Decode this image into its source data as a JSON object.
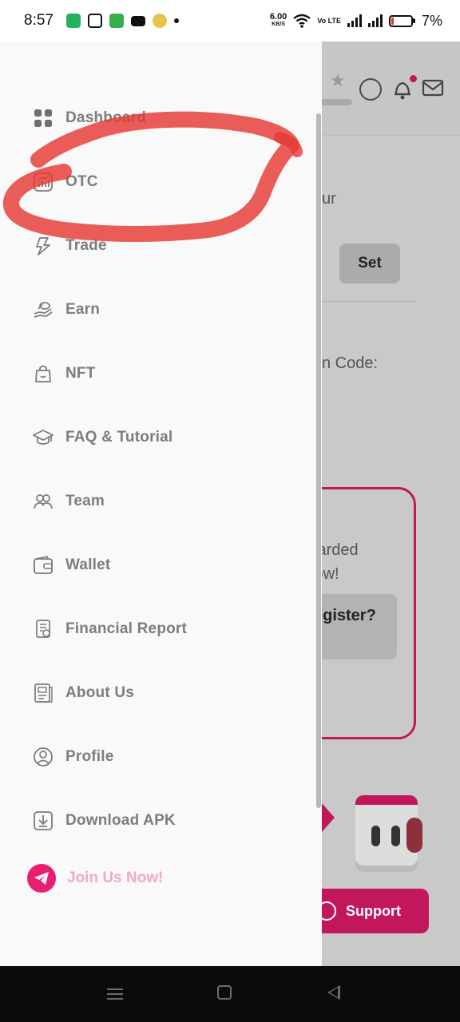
{
  "status_bar": {
    "time": "8:57",
    "net_speed": "6.00",
    "net_unit": "KB/S",
    "volte": "Vo LTE",
    "battery_pct": "7%",
    "notif_icons": [
      "battery-saver-icon",
      "instagram-icon",
      "app-icon",
      "mail-icon",
      "chat-icon",
      "dot-icon"
    ]
  },
  "background_app": {
    "text_our": "ur",
    "set_button": "Set",
    "code_label": "n Code:",
    "promo_line1": "warded",
    "promo_line2": "low!",
    "promo_btn": "egister?",
    "support_button": "Support"
  },
  "drawer": {
    "items": [
      {
        "label": "Dashboard",
        "icon": "grid-icon"
      },
      {
        "label": "OTC",
        "icon": "chart-icon"
      },
      {
        "label": "Trade",
        "icon": "trade-icon"
      },
      {
        "label": "Earn",
        "icon": "earn-icon"
      },
      {
        "label": "NFT",
        "icon": "bag-icon"
      },
      {
        "label": "FAQ & Tutorial",
        "icon": "graduation-cap-icon"
      },
      {
        "label": "Team",
        "icon": "team-icon"
      },
      {
        "label": "Wallet",
        "icon": "wallet-icon"
      },
      {
        "label": "Financial Report",
        "icon": "report-icon"
      },
      {
        "label": "About Us",
        "icon": "document-icon"
      },
      {
        "label": "Profile",
        "icon": "profile-icon"
      },
      {
        "label": "Download APK",
        "icon": "download-icon"
      }
    ],
    "join": {
      "label": "Join Us Now!",
      "icon": "telegram-icon"
    }
  },
  "colors": {
    "accent": "#e91e73",
    "brand_pink": "#c2185b",
    "menu_text": "#7d7d7d",
    "annotation": "#e53935"
  }
}
